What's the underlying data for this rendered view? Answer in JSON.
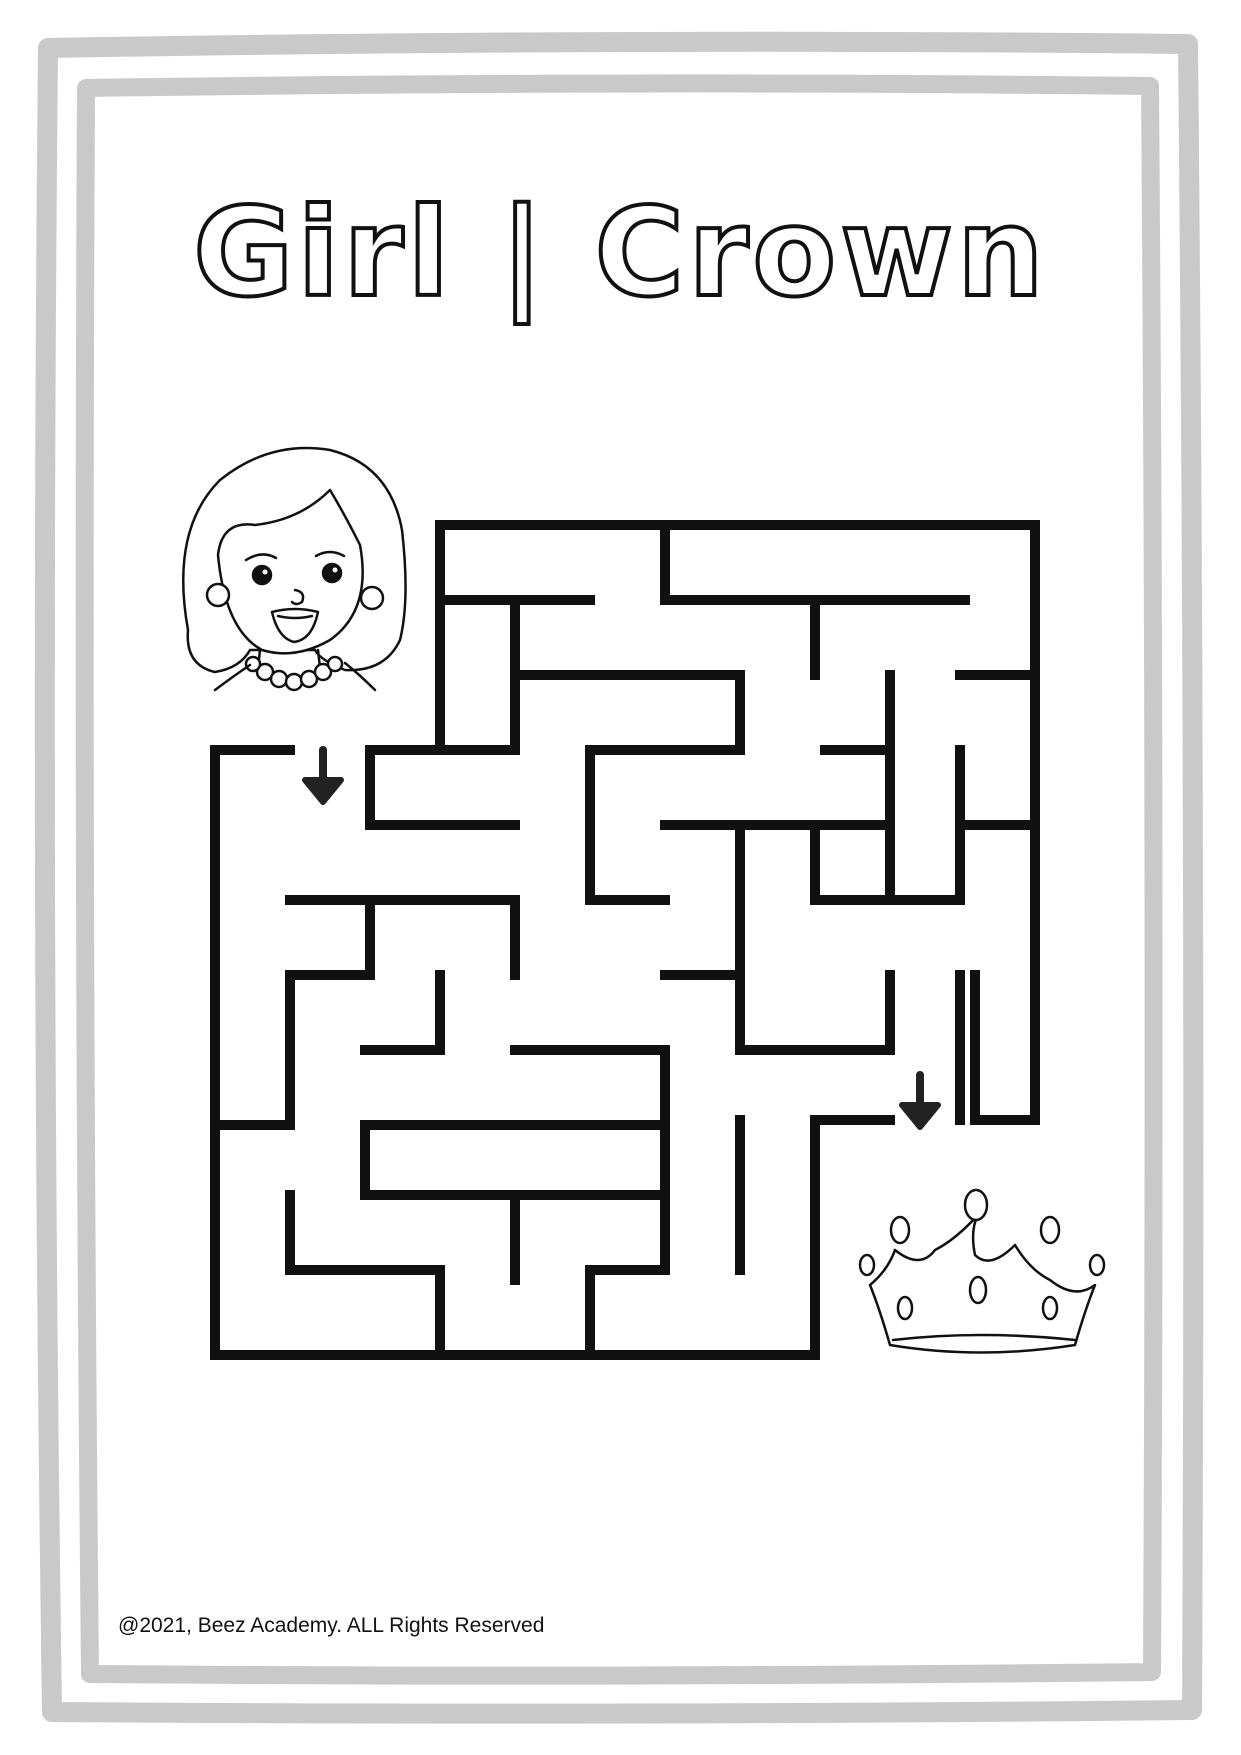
{
  "title": "Girl | Crown",
  "footer": {
    "copyright": "@2021, Beez Academy. ALL Rights Reserved"
  },
  "icons": {
    "start": "girl-face-icon",
    "finish": "crown-icon",
    "start_arrow": "down-arrow-icon",
    "finish_arrow": "down-arrow-icon"
  },
  "colors": {
    "frame": "#c9c9c9",
    "ink": "#111111",
    "background": "#ffffff"
  }
}
